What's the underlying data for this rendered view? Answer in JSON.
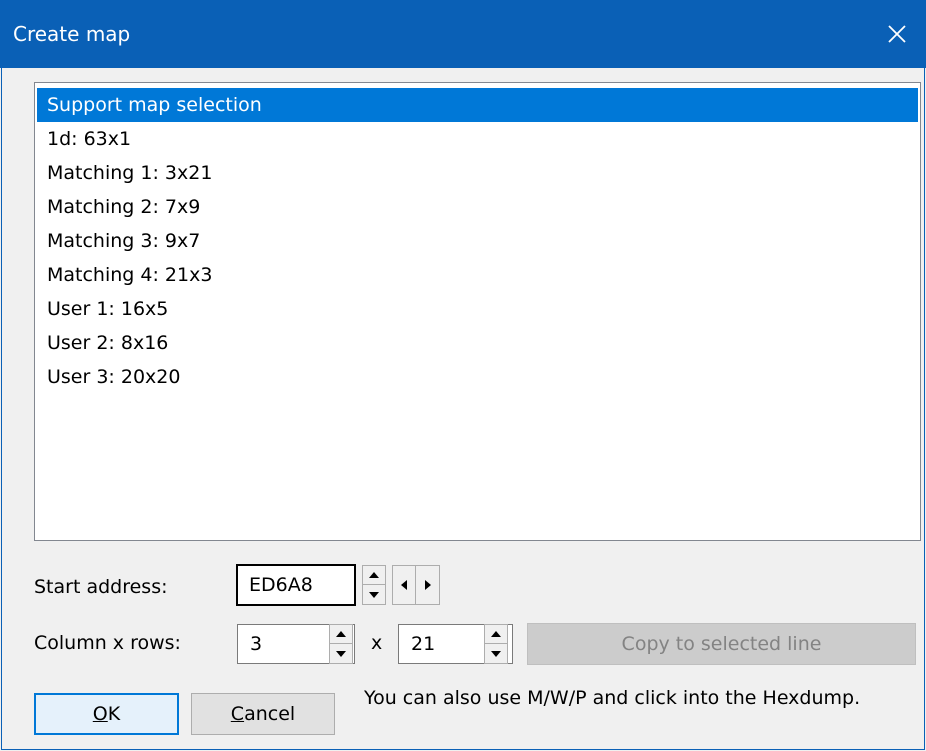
{
  "window": {
    "title": "Create map",
    "close_icon": "close-icon"
  },
  "list": {
    "items": [
      {
        "label": "Support map selection",
        "selected": true
      },
      {
        "label": "1d: 63x1"
      },
      {
        "label": "Matching 1: 3x21"
      },
      {
        "label": "Matching 2: 7x9"
      },
      {
        "label": "Matching 3: 9x7"
      },
      {
        "label": "Matching 4: 21x3"
      },
      {
        "label": "User 1: 16x5"
      },
      {
        "label": "User 2: 8x16"
      },
      {
        "label": "User 3: 20x20"
      }
    ],
    "selection_color": "#0078d7"
  },
  "start_address": {
    "label": "Start address:",
    "value": "ED6A8"
  },
  "columns_rows": {
    "label": "Column x rows:",
    "columns": "3",
    "separator": "x",
    "rows": "21",
    "copy_button": "Copy to selected line"
  },
  "buttons": {
    "ok_accel": "O",
    "ok_rest": "K",
    "cancel_accel": "C",
    "cancel_rest": "ancel"
  },
  "hint": "You can also use M/W/P and click into the Hexdump."
}
